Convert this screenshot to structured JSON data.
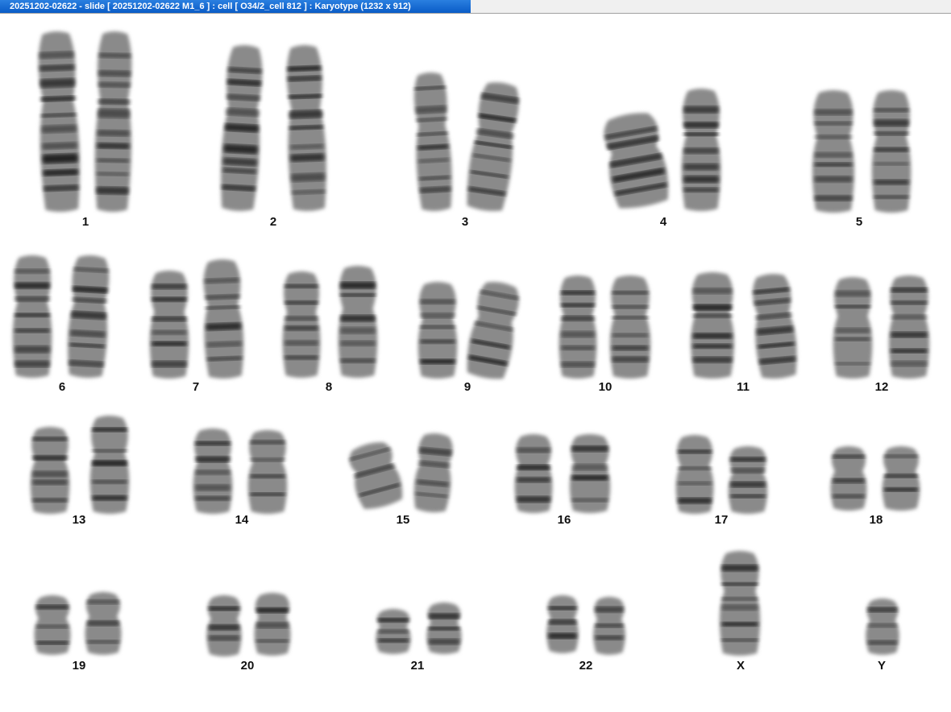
{
  "window": {
    "title": "20251202-02622 - slide [ 20251202-02622 M1_6 ] : cell [ O34/2_cell 812 ] : Karyotype  (1232 x 912)"
  },
  "karyotype": {
    "labels": [
      "1",
      "2",
      "3",
      "4",
      "5",
      "6",
      "7",
      "8",
      "9",
      "10",
      "11",
      "12",
      "13",
      "14",
      "15",
      "16",
      "17",
      "18",
      "19",
      "20",
      "21",
      "22",
      "X",
      "Y"
    ]
  },
  "colors": {
    "titlebar_active": "#0a5cc7",
    "titlebar_text": "#ffffff",
    "chromosome_dark": "#1e1e1e",
    "chromosome_light": "#8a8a8a",
    "background": "#ffffff"
  }
}
